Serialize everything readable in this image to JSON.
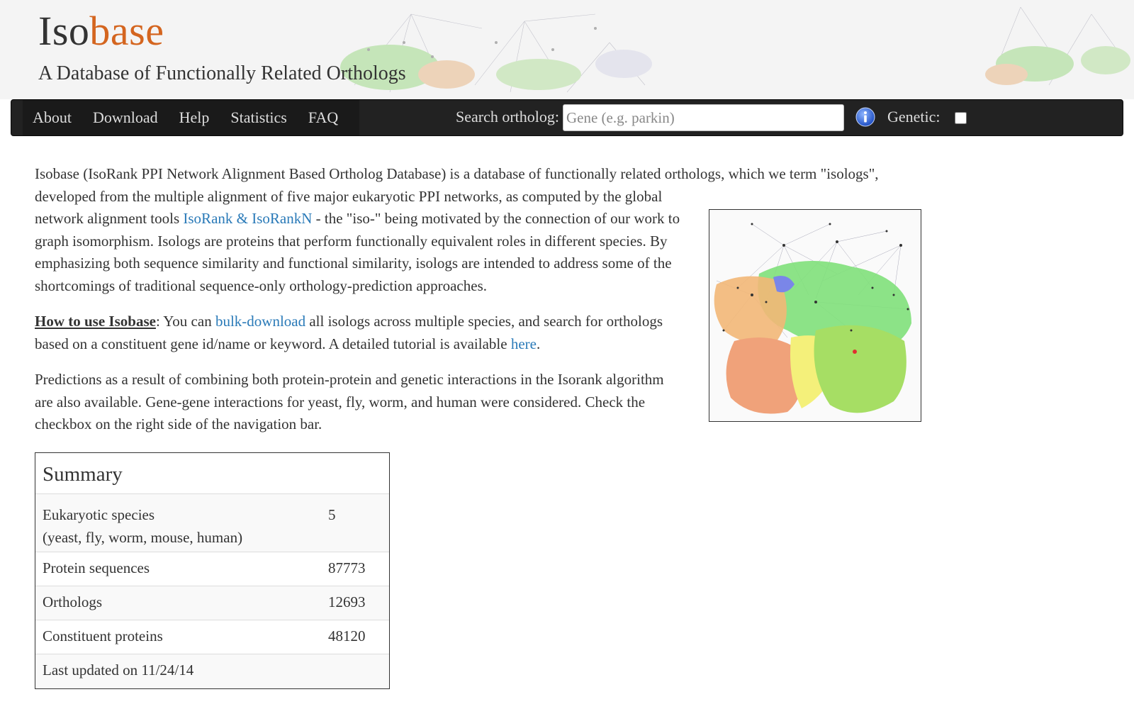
{
  "header": {
    "logo_part1": "Iso",
    "logo_part2": "base",
    "tagline": "A Database of Functionally Related Orthologs"
  },
  "nav": {
    "links": [
      "About",
      "Download",
      "Help",
      "Statistics",
      "FAQ"
    ],
    "search_label": "Search ortholog:",
    "search_placeholder": "Gene (e.g. parkin)",
    "search_value": "",
    "genetic_label": "Genetic:",
    "genetic_checked": false
  },
  "intro": {
    "p1_text": "Isobase (IsoRank PPI Network Alignment Based Ortholog Database) is a database of functionally related orthologs, which we term \"isologs\", developed from the multiple alignment of five major eukaryotic PPI networks, as computed by the global network alignment tools ",
    "p1_link": "IsoRank & IsoRankN",
    "p1_text2": " - the \"iso-\" being motivated by the connection of our work to graph isomorphism. Isologs are proteins that perform functionally equivalent roles in different species. By emphasizing both sequence similarity and functional similarity, isologs are intended to address some of the shortcomings of traditional sequence-only orthology-prediction approaches.",
    "p2_heading": "How to use Isobase",
    "p2_text": ": You can ",
    "p2_link1": "bulk-download",
    "p2_text2": " all isologs across multiple species, and search for orthologs based on a constituent gene id/name or keyword. A detailed tutorial is available ",
    "p2_link2": "here",
    "p2_text3": ".",
    "p3_text": "Predictions as a result of combining both protein-protein and genetic interactions in the Isorank algorithm are also available. Gene-gene interactions for yeast, fly, worm, and human were considered. Check the checkbox on the right side of the navigation bar."
  },
  "summary": {
    "title": "Summary",
    "species_label": "Eukaryotic species",
    "species_sub": "(yeast, fly, worm, mouse, human)",
    "species_value": "5",
    "rows": [
      {
        "label": "Protein sequences",
        "value": "87773"
      },
      {
        "label": "Orthologs",
        "value": "12693"
      },
      {
        "label": "Constituent proteins",
        "value": "48120"
      }
    ],
    "updated": "Last updated on 11/24/14"
  },
  "colors": {
    "brand_orange": "#d4651f",
    "link_blue": "#2a7ab8",
    "navbar_bg": "#222222"
  }
}
